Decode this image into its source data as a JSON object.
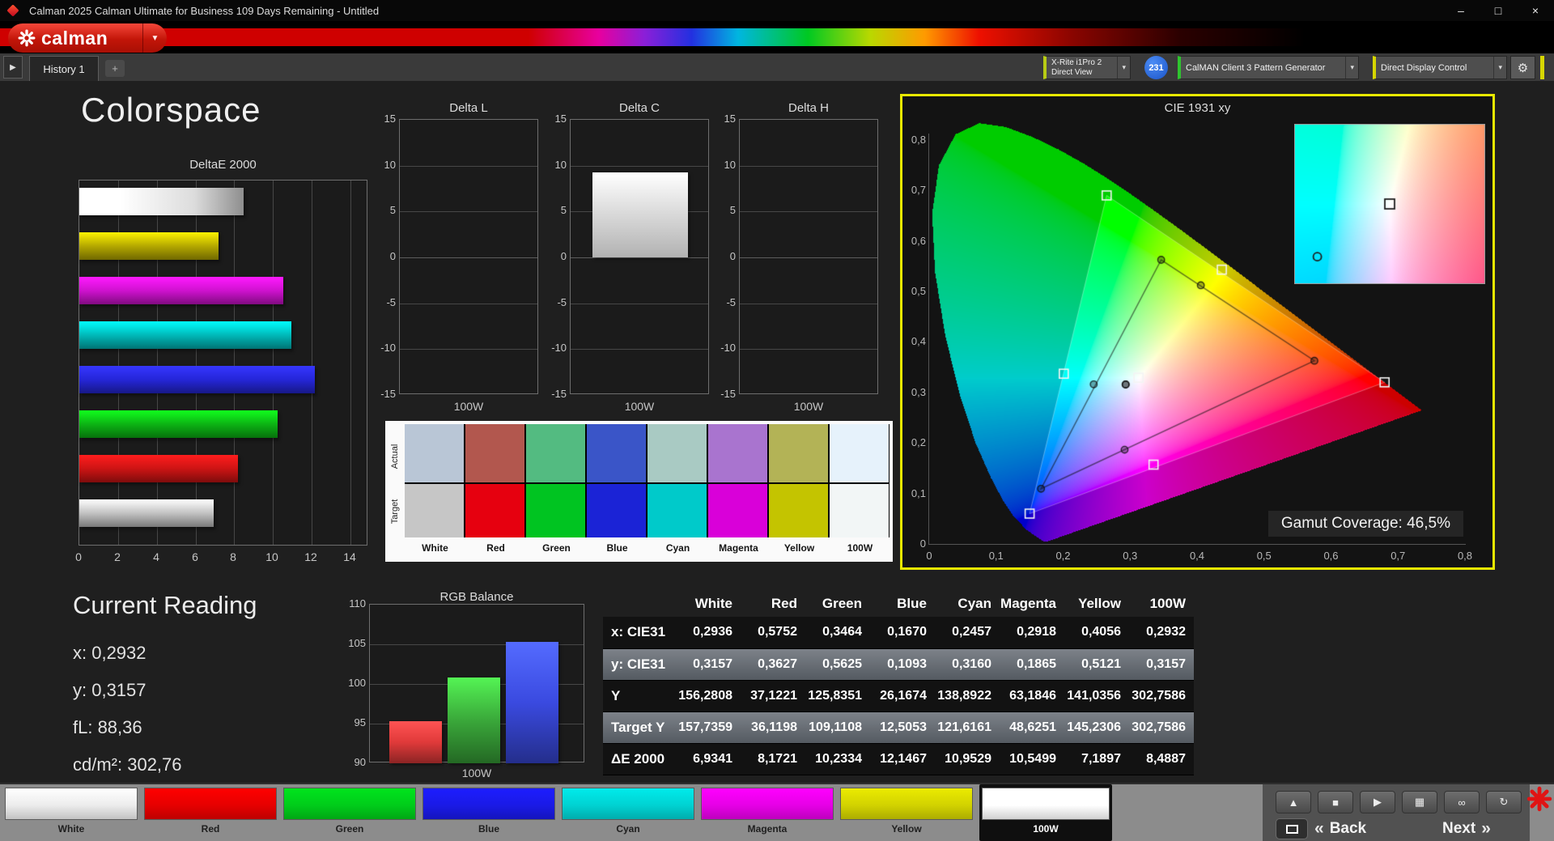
{
  "titlebar": {
    "title": "Calman 2025 Calman Ultimate for Business 109 Days Remaining  - Untitled",
    "minimize": "–",
    "maximize": "□",
    "close": "×"
  },
  "header": {
    "logo_text": "calman",
    "logo_arrow": "▼",
    "nav_arrow": "▶",
    "tab": "History 1",
    "add_tab": "+",
    "meter": {
      "line1": "X-Rite i1Pro 2",
      "line2": "Direct View",
      "badge": "231",
      "arrow": "▾"
    },
    "source": {
      "label": "CalMAN Client 3 Pattern Generator",
      "arrow": "▾"
    },
    "display": {
      "label": "Direct Display Control",
      "arrow": "▾"
    },
    "gear": "⚙"
  },
  "page_title": "Colorspace",
  "current_reading": {
    "title": "Current Reading",
    "x": "x: 0,2932",
    "y": "y: 0,3157",
    "fl": "fL: 88,36",
    "cdm2": "cd/m²: 302,76"
  },
  "chart_data": [
    {
      "id": "deltae2000",
      "type": "bar",
      "orientation": "horizontal",
      "title": "DeltaE 2000",
      "categories": [
        "100W",
        "Yellow",
        "Magenta",
        "Cyan",
        "Blue",
        "Green",
        "Red",
        "White"
      ],
      "values": [
        8.4887,
        7.1897,
        10.5499,
        10.9529,
        12.1467,
        10.2334,
        8.1721,
        6.9341
      ],
      "colors": [
        "#f2f2f2",
        "#b4a800",
        "#cf12cf",
        "#00b9b9",
        "#2526d8",
        "#0cb414",
        "#cc1414",
        "#c2c2c2"
      ],
      "xlim": [
        0,
        14
      ],
      "xticks": [
        0,
        2,
        4,
        6,
        8,
        10,
        12,
        14
      ]
    },
    {
      "id": "delta_l",
      "type": "bar",
      "title": "Delta L",
      "categories": [
        "100W"
      ],
      "values": [
        0
      ],
      "ylim": [
        -15,
        15
      ],
      "yticks": [
        15,
        10,
        5,
        0,
        -5,
        -10,
        -15
      ],
      "xlabel": "100W"
    },
    {
      "id": "delta_c",
      "type": "bar",
      "title": "Delta C",
      "categories": [
        "100W"
      ],
      "values": [
        9.3
      ],
      "ylim": [
        -15,
        15
      ],
      "yticks": [
        15,
        10,
        5,
        0,
        -5,
        -10,
        -15
      ],
      "xlabel": "100W"
    },
    {
      "id": "delta_h",
      "type": "bar",
      "title": "Delta H",
      "categories": [
        "100W"
      ],
      "values": [
        0
      ],
      "ylim": [
        -15,
        15
      ],
      "yticks": [
        15,
        10,
        5,
        0,
        -5,
        -10,
        -15
      ],
      "xlabel": "100W"
    },
    {
      "id": "rgb_balance",
      "type": "bar",
      "title": "RGB Balance",
      "categories": [
        "Red",
        "Green",
        "Blue"
      ],
      "values": [
        95.3,
        100.8,
        105.3
      ],
      "colors": [
        "#e03a3a",
        "#3aa83a",
        "#3a4ae0"
      ],
      "ylim": [
        90,
        110
      ],
      "yticks": [
        110,
        105,
        100,
        95,
        90
      ],
      "xlabel": "100W"
    },
    {
      "id": "cie1931",
      "type": "scatter",
      "title": "CIE 1931 xy",
      "xlim": [
        0,
        0.8
      ],
      "ylim": [
        0,
        0.8
      ],
      "tick_labels": [
        "0",
        "0,1",
        "0,2",
        "0,3",
        "0,4",
        "0,5",
        "0,6",
        "0,7",
        "0,8"
      ],
      "target_triangle": {
        "red": [
          0.68,
          0.32
        ],
        "green": [
          0.265,
          0.69
        ],
        "blue": [
          0.15,
          0.06
        ]
      },
      "target_secondaries": {
        "cyan": [
          0.201,
          0.337
        ],
        "magenta": [
          0.335,
          0.157
        ],
        "yellow": [
          0.437,
          0.543
        ],
        "white": [
          0.3127,
          0.329
        ]
      },
      "measured": {
        "white": [
          0.2936,
          0.3157
        ],
        "red": [
          0.5752,
          0.3627
        ],
        "green": [
          0.3464,
          0.5625
        ],
        "blue": [
          0.167,
          0.1093
        ],
        "cyan": [
          0.2457,
          0.316
        ],
        "magenta": [
          0.2918,
          0.1865
        ],
        "yellow": [
          0.4056,
          0.5121
        ],
        "w100": [
          0.2932,
          0.3157
        ]
      },
      "inset_range": {
        "x": [
          0.2877,
          0.3377
        ],
        "y": [
          0.309,
          0.349
        ]
      },
      "gamut_coverage": "Gamut Coverage:  46,5%"
    },
    {
      "id": "measurement_table",
      "type": "table",
      "columns": [
        "",
        "White",
        "Red",
        "Green",
        "Blue",
        "Cyan",
        "Magenta",
        "Yellow",
        "100W"
      ],
      "rows": [
        {
          "label": "x: CIE31",
          "values": [
            "0,2936",
            "0,5752",
            "0,3464",
            "0,1670",
            "0,2457",
            "0,2918",
            "0,4056",
            "0,2932"
          ]
        },
        {
          "label": "y: CIE31",
          "values": [
            "0,3157",
            "0,3627",
            "0,5625",
            "0,1093",
            "0,3160",
            "0,1865",
            "0,5121",
            "0,3157"
          ]
        },
        {
          "label": "Y",
          "values": [
            "156,2808",
            "37,1221",
            "125,8351",
            "26,1674",
            "138,8922",
            "63,1846",
            "141,0356",
            "302,7586"
          ]
        },
        {
          "label": "Target Y",
          "values": [
            "157,7359",
            "36,1198",
            "109,1108",
            "12,5053",
            "121,6161",
            "48,6251",
            "145,2306",
            "302,7586"
          ]
        },
        {
          "label": "ΔE 2000",
          "values": [
            "6,9341",
            "8,1721",
            "10,2334",
            "12,1467",
            "10,9529",
            "10,5499",
            "7,1897",
            "8,4887"
          ]
        }
      ]
    }
  ],
  "swatches": {
    "row_labels": [
      "Actual",
      "Target"
    ],
    "columns": [
      "White",
      "Red",
      "Green",
      "Blue",
      "Cyan",
      "Magenta",
      "Yellow",
      "100W"
    ],
    "actual": [
      "#b9c6d6",
      "#b2574e",
      "#53bb81",
      "#3a55c8",
      "#a9cac3",
      "#a974cf",
      "#b3b356",
      "#e6f2fb"
    ],
    "target": [
      "#c6c6c6",
      "#e6000f",
      "#00c421",
      "#1b23d6",
      "#00caca",
      "#d900d9",
      "#c4c400",
      "#f2f6f6"
    ]
  },
  "bottom_bar": {
    "patterns": [
      {
        "label": "White",
        "color": "#ececec"
      },
      {
        "label": "Red",
        "color": "#e60000"
      },
      {
        "label": "Green",
        "color": "#00cc1a"
      },
      {
        "label": "Blue",
        "color": "#1a1ae6"
      },
      {
        "label": "Cyan",
        "color": "#00d2d2"
      },
      {
        "label": "Magenta",
        "color": "#e600e6"
      },
      {
        "label": "Yellow",
        "color": "#d2d200"
      },
      {
        "label": "100W",
        "color": "#ffffff",
        "selected": true
      }
    ],
    "transport": [
      {
        "name": "eject",
        "glyph": "▲"
      },
      {
        "name": "stop",
        "glyph": "■"
      },
      {
        "name": "play",
        "glyph": "▶"
      },
      {
        "name": "save",
        "glyph": "▦"
      },
      {
        "name": "continuous",
        "glyph": "∞"
      },
      {
        "name": "refresh",
        "glyph": "↻"
      }
    ],
    "back_chevron": "«",
    "back": "Back",
    "next": "Next",
    "next_chevron": "»"
  }
}
